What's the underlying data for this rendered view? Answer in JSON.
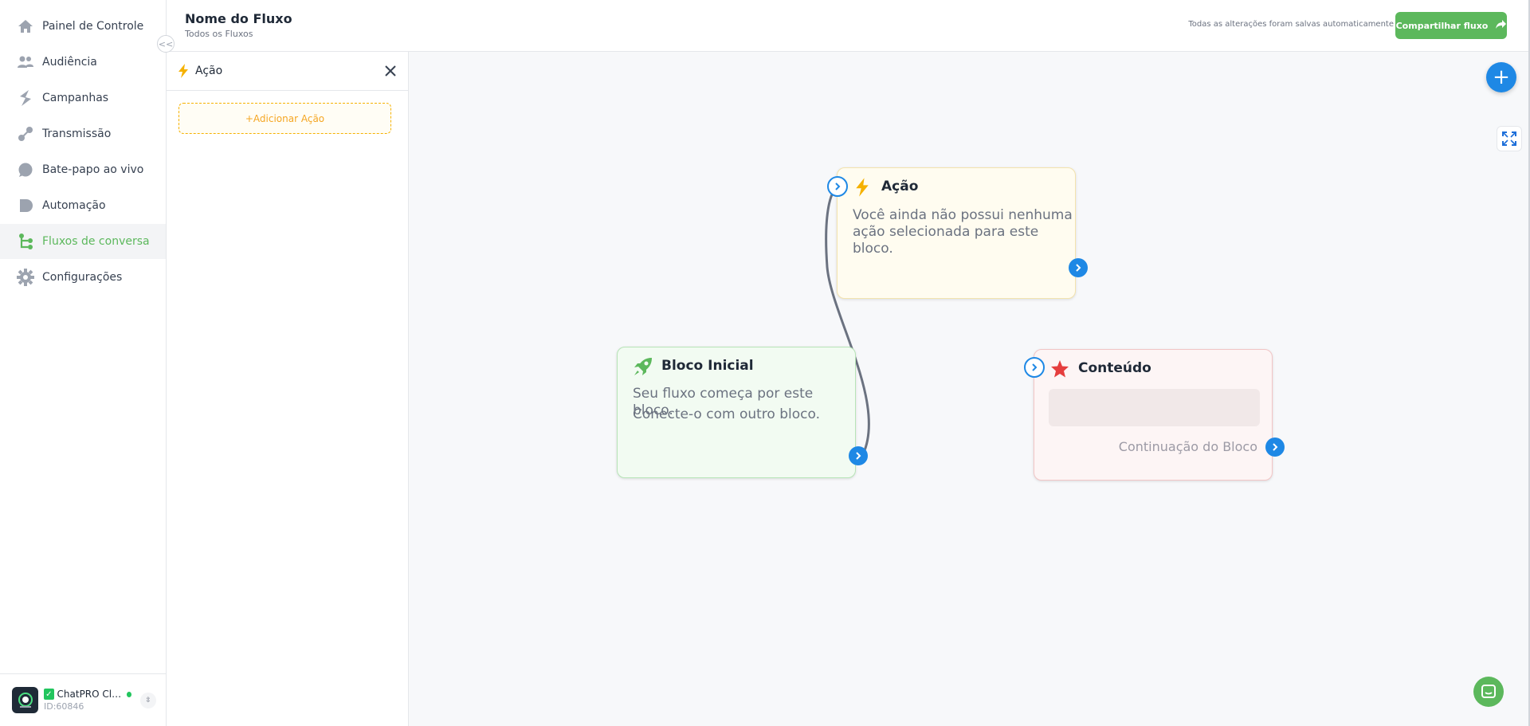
{
  "sidebar": {
    "items": [
      {
        "label": "Painel de Controle",
        "icon": "home-icon"
      },
      {
        "label": "Audiência",
        "icon": "users-icon"
      },
      {
        "label": "Campanhas",
        "icon": "campaign-icon"
      },
      {
        "label": "Transmissão",
        "icon": "broadcast-icon"
      },
      {
        "label": "Bate-papo ao vivo",
        "icon": "chat-bubble-icon"
      },
      {
        "label": "Automação",
        "icon": "automation-icon"
      },
      {
        "label": "Fluxos de conversa",
        "icon": "flow-icon",
        "active": true
      },
      {
        "label": "Configurações",
        "icon": "gear-icon"
      }
    ],
    "collapse_label": "<<",
    "account": {
      "name": "ChatPRO Clie...",
      "id": "ID:60846",
      "verified_mark": "✓"
    }
  },
  "header": {
    "title": "Nome do Fluxo",
    "subtitle": "Todos os Fluxos",
    "saved_note": "Todas as alterações foram salvas automaticamente",
    "share_label": "Compartilhar fluxo"
  },
  "panel": {
    "title": "Ação",
    "add_action_label": "+Adicionar Ação"
  },
  "canvas": {
    "nodes": {
      "start": {
        "title": "Bloco Inicial",
        "desc_line1": "Seu fluxo começa por este bloco.",
        "desc_line2": "Conecte-o com outro bloco."
      },
      "action": {
        "title": "Ação",
        "desc_line1": "Você ainda não possui nenhuma",
        "desc_line2": "ação selecionada para este bloco."
      },
      "content": {
        "title": "Conteúdo",
        "continuation": "Continuação do Bloco"
      }
    },
    "add_button_label": "+"
  },
  "colors": {
    "brand_green": "#5cb85c",
    "accent_blue": "#1e88e5",
    "action_yellow": "#f5b100",
    "content_red": "#e53e3e"
  }
}
